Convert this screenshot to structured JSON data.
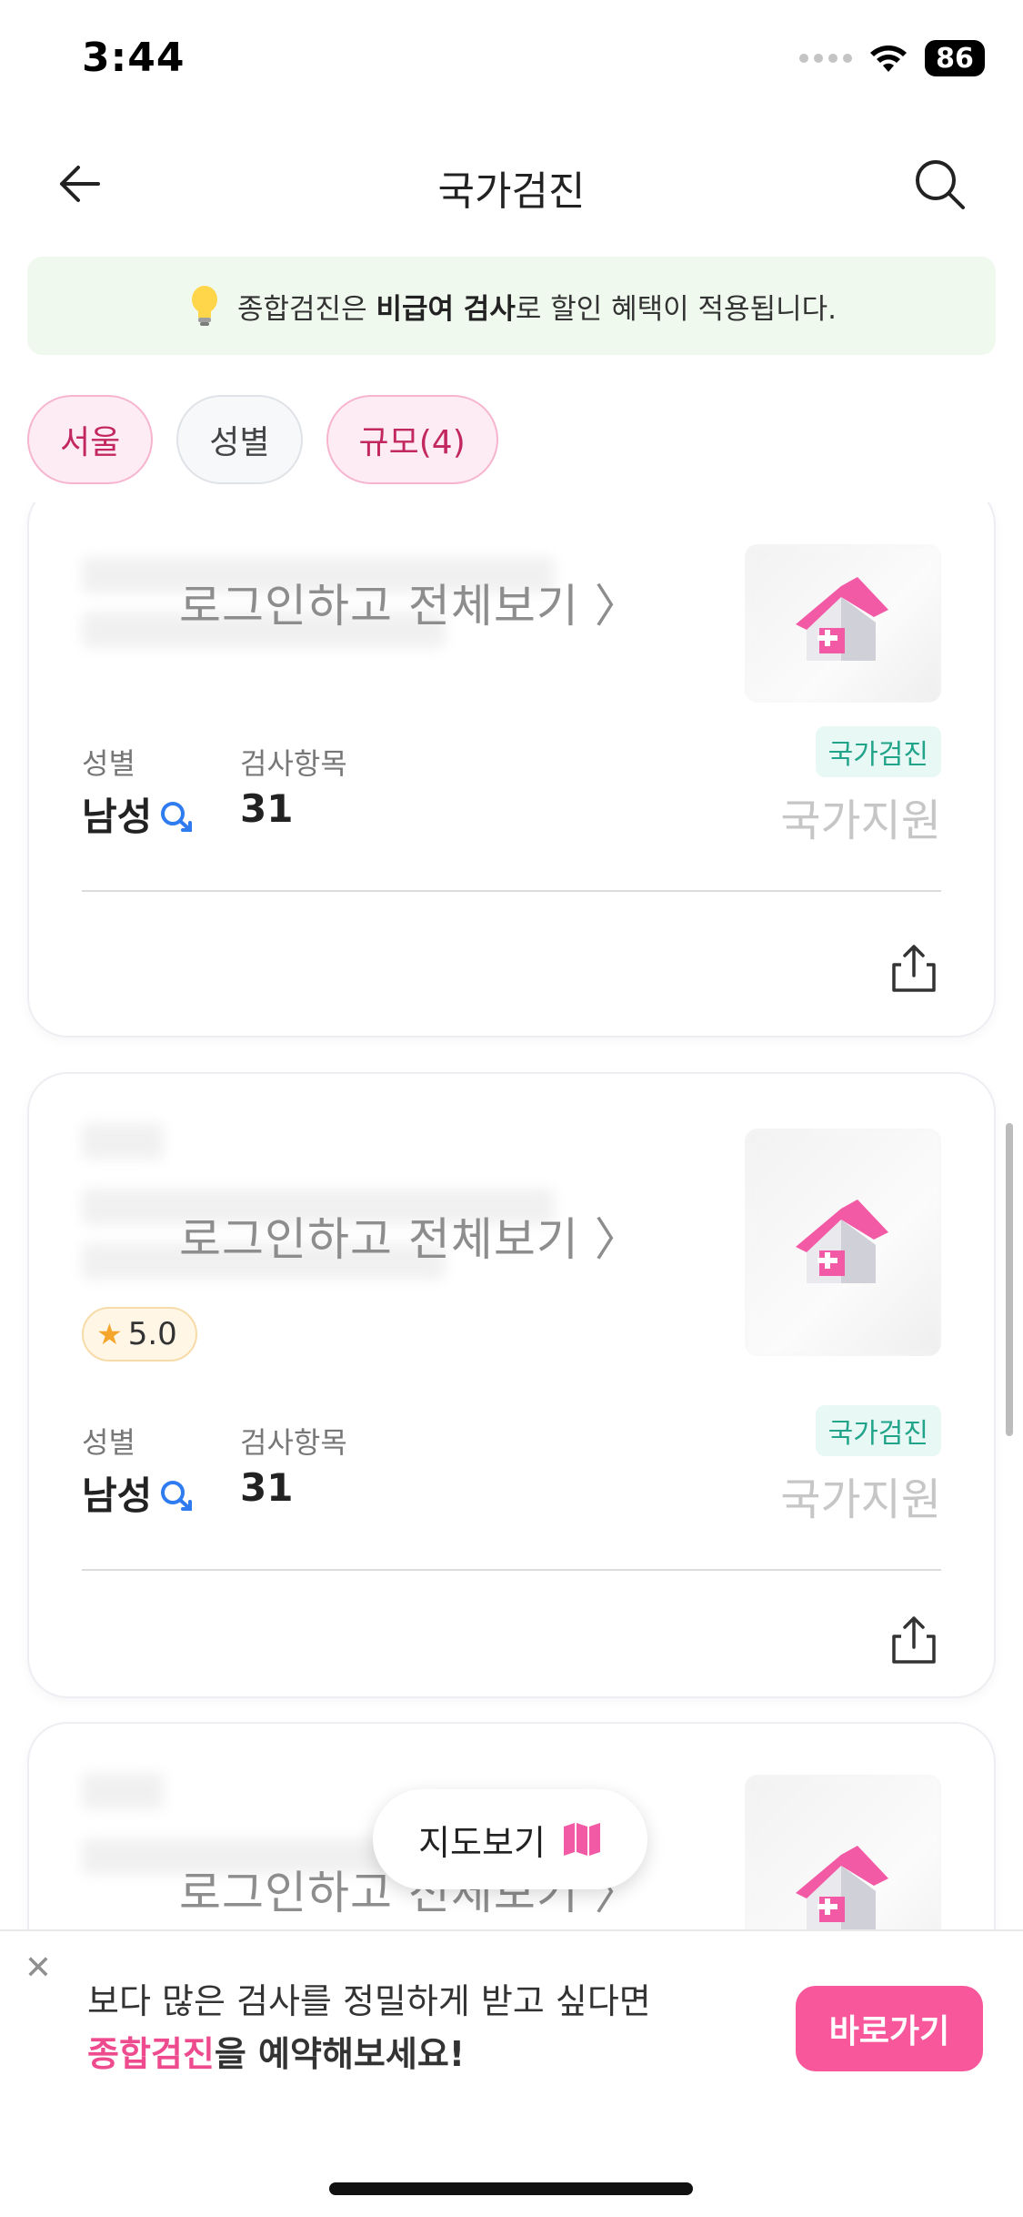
{
  "status_bar": {
    "time": "3:44",
    "battery": "86"
  },
  "header": {
    "title": "국가검진"
  },
  "notice": {
    "prefix": "종합검진은 ",
    "bold": "비급여 검사",
    "suffix": "로 할인 혜택이 적용됩니다."
  },
  "filters": [
    {
      "label": "서울",
      "active": true
    },
    {
      "label": "성별",
      "active": false
    },
    {
      "label": "규모(4)",
      "active": true
    }
  ],
  "cards": [
    {
      "login_text": "로그인하고 전체보기 〉",
      "gender_label": "성별",
      "gender_value": "남성",
      "items_label": "검사항목",
      "items_value": "31",
      "tag": "국가검진",
      "support": "국가지원"
    },
    {
      "login_text": "로그인하고 전체보기 〉",
      "rating": "5.0",
      "gender_label": "성별",
      "gender_value": "남성",
      "items_label": "검사항목",
      "items_value": "31",
      "tag": "국가검진",
      "support": "국가지원"
    },
    {
      "login_text": "로그인하고 전체보기 〉"
    }
  ],
  "map_button": {
    "label": "지도보기"
  },
  "promo": {
    "line1": "보다 많은 검사를 정밀하게 받고 싶다면",
    "highlight": "종합검진",
    "line2_suffix": "을 예약해보세요!",
    "cta": "바로가기"
  },
  "colors": {
    "accent": "#f8579c",
    "tag": "#21a48a",
    "notice_bg": "#eff9ee"
  }
}
